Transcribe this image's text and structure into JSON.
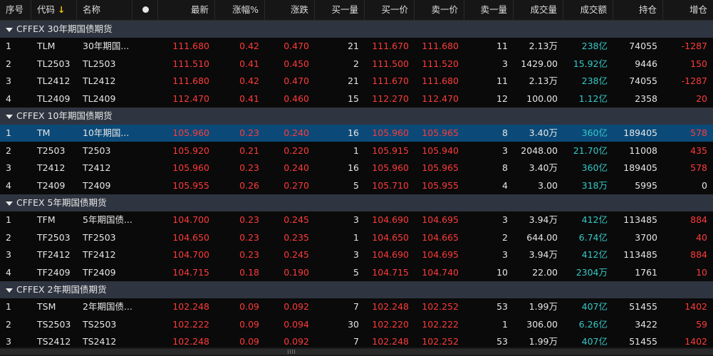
{
  "header": {
    "seq": "序号",
    "code": "代码",
    "sort_arrow": "↓",
    "name": "名称",
    "latest": "最新",
    "pct": "涨幅%",
    "change": "涨跌",
    "bid_vol": "买一量",
    "bid": "买一价",
    "ask": "卖一价",
    "ask_vol": "卖一量",
    "volume": "成交量",
    "amount": "成交额",
    "oi": "持仓",
    "oi_chg": "增仓"
  },
  "colors": {
    "up": "#ff3a3a",
    "flat": "#e6e6e6",
    "amount": "#36c8c8",
    "selected_row": "#0b4a78",
    "group_bg": "#2e3440"
  },
  "groups": [
    {
      "title": "CFFEX 30年期国债期货",
      "rows": [
        {
          "seq": "1",
          "code": "TLM",
          "name": "30年期国...",
          "latest": "111.680",
          "pct": "0.42",
          "change": "0.470",
          "bid_vol": "21",
          "bid": "111.670",
          "ask": "111.680",
          "ask_vol": "11",
          "volume": "2.13万",
          "amount": "238亿",
          "oi": "74055",
          "oi_chg": "-1287"
        },
        {
          "seq": "2",
          "code": "TL2503",
          "name": "TL2503",
          "latest": "111.510",
          "pct": "0.41",
          "change": "0.450",
          "bid_vol": "2",
          "bid": "111.500",
          "ask": "111.520",
          "ask_vol": "3",
          "volume": "1429.00",
          "amount": "15.92亿",
          "oi": "9446",
          "oi_chg": "150"
        },
        {
          "seq": "3",
          "code": "TL2412",
          "name": "TL2412",
          "latest": "111.680",
          "pct": "0.42",
          "change": "0.470",
          "bid_vol": "21",
          "bid": "111.670",
          "ask": "111.680",
          "ask_vol": "11",
          "volume": "2.13万",
          "amount": "238亿",
          "oi": "74055",
          "oi_chg": "-1287"
        },
        {
          "seq": "4",
          "code": "TL2409",
          "name": "TL2409",
          "latest": "112.470",
          "pct": "0.41",
          "change": "0.460",
          "bid_vol": "15",
          "bid": "112.270",
          "ask": "112.470",
          "ask_vol": "12",
          "volume": "100.00",
          "amount": "1.12亿",
          "oi": "2358",
          "oi_chg": "20"
        }
      ]
    },
    {
      "title": "CFFEX 10年期国债期货",
      "rows": [
        {
          "seq": "1",
          "code": "TM",
          "name": "10年期国...",
          "latest": "105.960",
          "pct": "0.23",
          "change": "0.240",
          "bid_vol": "16",
          "bid": "105.960",
          "ask": "105.965",
          "ask_vol": "8",
          "volume": "3.40万",
          "amount": "360亿",
          "oi": "189405",
          "oi_chg": "578",
          "selected": true
        },
        {
          "seq": "2",
          "code": "T2503",
          "name": "T2503",
          "latest": "105.920",
          "pct": "0.21",
          "change": "0.220",
          "bid_vol": "1",
          "bid": "105.915",
          "ask": "105.940",
          "ask_vol": "3",
          "volume": "2048.00",
          "amount": "21.70亿",
          "oi": "11008",
          "oi_chg": "435"
        },
        {
          "seq": "3",
          "code": "T2412",
          "name": "T2412",
          "latest": "105.960",
          "pct": "0.23",
          "change": "0.240",
          "bid_vol": "16",
          "bid": "105.960",
          "ask": "105.965",
          "ask_vol": "8",
          "volume": "3.40万",
          "amount": "360亿",
          "oi": "189405",
          "oi_chg": "578"
        },
        {
          "seq": "4",
          "code": "T2409",
          "name": "T2409",
          "latest": "105.955",
          "pct": "0.26",
          "change": "0.270",
          "bid_vol": "5",
          "bid": "105.710",
          "ask": "105.955",
          "ask_vol": "4",
          "volume": "3.00",
          "amount": "318万",
          "oi": "5995",
          "oi_chg": "0"
        }
      ]
    },
    {
      "title": "CFFEX 5年期国债期货",
      "rows": [
        {
          "seq": "1",
          "code": "TFM",
          "name": "5年期国债...",
          "latest": "104.700",
          "pct": "0.23",
          "change": "0.245",
          "bid_vol": "3",
          "bid": "104.690",
          "ask": "104.695",
          "ask_vol": "3",
          "volume": "3.94万",
          "amount": "412亿",
          "oi": "113485",
          "oi_chg": "884"
        },
        {
          "seq": "2",
          "code": "TF2503",
          "name": "TF2503",
          "latest": "104.650",
          "pct": "0.23",
          "change": "0.235",
          "bid_vol": "1",
          "bid": "104.650",
          "ask": "104.665",
          "ask_vol": "2",
          "volume": "644.00",
          "amount": "6.74亿",
          "oi": "3700",
          "oi_chg": "40"
        },
        {
          "seq": "3",
          "code": "TF2412",
          "name": "TF2412",
          "latest": "104.700",
          "pct": "0.23",
          "change": "0.245",
          "bid_vol": "3",
          "bid": "104.690",
          "ask": "104.695",
          "ask_vol": "3",
          "volume": "3.94万",
          "amount": "412亿",
          "oi": "113485",
          "oi_chg": "884"
        },
        {
          "seq": "4",
          "code": "TF2409",
          "name": "TF2409",
          "latest": "104.715",
          "pct": "0.18",
          "change": "0.190",
          "bid_vol": "5",
          "bid": "104.715",
          "ask": "104.740",
          "ask_vol": "10",
          "volume": "22.00",
          "amount": "2304万",
          "oi": "1761",
          "oi_chg": "10"
        }
      ]
    },
    {
      "title": "CFFEX 2年期国债期货",
      "rows": [
        {
          "seq": "1",
          "code": "TSM",
          "name": "2年期国债...",
          "latest": "102.248",
          "pct": "0.09",
          "change": "0.092",
          "bid_vol": "7",
          "bid": "102.248",
          "ask": "102.252",
          "ask_vol": "53",
          "volume": "1.99万",
          "amount": "407亿",
          "oi": "51455",
          "oi_chg": "1402"
        },
        {
          "seq": "2",
          "code": "TS2503",
          "name": "TS2503",
          "latest": "102.222",
          "pct": "0.09",
          "change": "0.094",
          "bid_vol": "30",
          "bid": "102.220",
          "ask": "102.222",
          "ask_vol": "1",
          "volume": "306.00",
          "amount": "6.26亿",
          "oi": "3422",
          "oi_chg": "59"
        },
        {
          "seq": "3",
          "code": "TS2412",
          "name": "TS2412",
          "latest": "102.248",
          "pct": "0.09",
          "change": "0.092",
          "bid_vol": "7",
          "bid": "102.248",
          "ask": "102.252",
          "ask_vol": "53",
          "volume": "1.99万",
          "amount": "407亿",
          "oi": "51455",
          "oi_chg": "1402"
        }
      ]
    }
  ]
}
